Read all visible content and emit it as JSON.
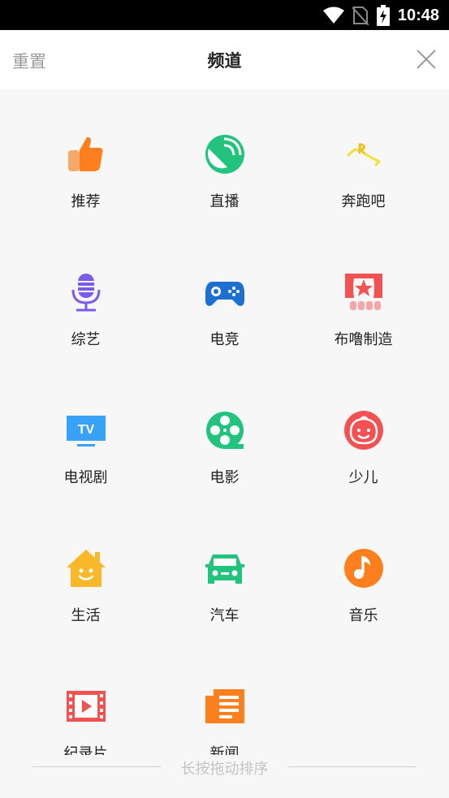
{
  "status_bar": {
    "time": "10:48"
  },
  "header": {
    "reset_label": "重置",
    "title": "频道"
  },
  "channels": [
    {
      "label": "推荐",
      "icon": "thumbs-up-icon",
      "color": "#fd7f1e"
    },
    {
      "label": "直播",
      "icon": "live-broadcast-icon",
      "color": "#22c47d"
    },
    {
      "label": "奔跑吧",
      "icon": "running-man-logo-icon",
      "color": "#f2e13a"
    },
    {
      "label": "综艺",
      "icon": "microphone-icon",
      "color": "#7a5ce8"
    },
    {
      "label": "电竞",
      "icon": "gamepad-icon",
      "color": "#1d6fd1"
    },
    {
      "label": "布噜制造",
      "icon": "theater-stage-icon",
      "color": "#f25252"
    },
    {
      "label": "电视剧",
      "icon": "tv-icon",
      "color": "#3aa2f5"
    },
    {
      "label": "电影",
      "icon": "film-reel-icon",
      "color": "#22c47d"
    },
    {
      "label": "少儿",
      "icon": "baby-face-icon",
      "color": "#f25252"
    },
    {
      "label": "生活",
      "icon": "house-icon",
      "color": "#f8b827"
    },
    {
      "label": "汽车",
      "icon": "car-icon",
      "color": "#22c47d"
    },
    {
      "label": "音乐",
      "icon": "music-note-icon",
      "color": "#fd7f1e"
    },
    {
      "label": "纪录片",
      "icon": "film-strip-icon",
      "color": "#f25252"
    },
    {
      "label": "新闻",
      "icon": "news-icon",
      "color": "#fd7f1e"
    }
  ],
  "footer": {
    "hint": "长按拖动排序"
  }
}
